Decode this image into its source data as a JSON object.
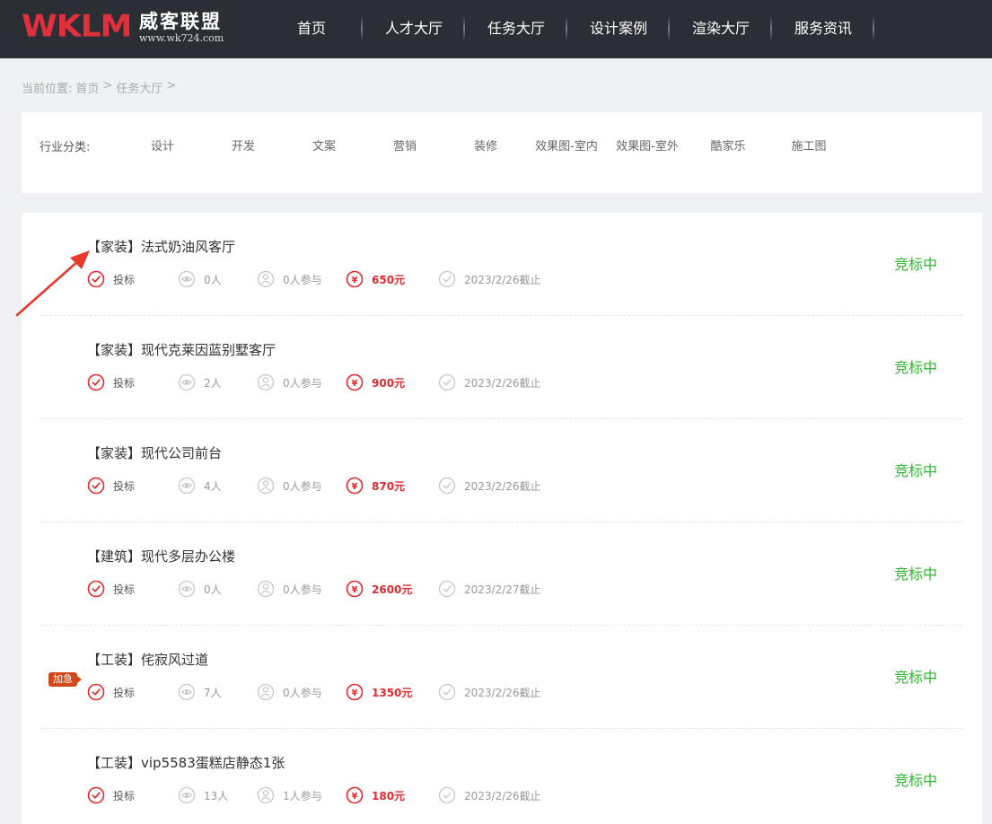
{
  "header": {
    "logo_mark": "WKLM",
    "logo_cn": "威客联盟",
    "logo_url": "www.wk724.com",
    "nav": [
      "首页",
      "人才大厅",
      "任务大厅",
      "设计案例",
      "渲染大厅",
      "服务资讯"
    ]
  },
  "breadcrumb": {
    "prefix": "当前位置:",
    "items": [
      "首页",
      ">",
      "任务大厅",
      ">"
    ]
  },
  "filter": {
    "label": "行业分类:",
    "options": [
      "设计",
      "开发",
      "文案",
      "营销",
      "装修",
      "效果图-室内",
      "效果图-室外",
      "酷家乐",
      "施工图"
    ]
  },
  "tasks": [
    {
      "title": "【家装】法式奶油风客厅",
      "bid": "投标",
      "views": "0人",
      "participants": "0人参与",
      "price": "650元",
      "deadline": "2023/2/26截止",
      "status": "竞标中"
    },
    {
      "title": "【家装】现代克莱因蓝别墅客厅",
      "bid": "投标",
      "views": "2人",
      "participants": "0人参与",
      "price": "900元",
      "deadline": "2023/2/26截止",
      "status": "竞标中"
    },
    {
      "title": "【家装】现代公司前台",
      "bid": "投标",
      "views": "4人",
      "participants": "0人参与",
      "price": "870元",
      "deadline": "2023/2/26截止",
      "status": "竞标中"
    },
    {
      "title": "【建筑】现代多层办公楼",
      "bid": "投标",
      "views": "0人",
      "participants": "0人参与",
      "price": "2600元",
      "deadline": "2023/2/27截止",
      "status": "竞标中"
    },
    {
      "title": "【工装】侘寂风过道",
      "badge": "加急",
      "bid": "投标",
      "views": "7人",
      "participants": "0人参与",
      "price": "1350元",
      "deadline": "2023/2/26截止",
      "status": "竞标中"
    },
    {
      "title": "【工装】vip5583蛋糕店静态1张",
      "bid": "投标",
      "views": "13人",
      "participants": "1人参与",
      "price": "180元",
      "deadline": "2023/2/26截止",
      "status": "竞标中"
    }
  ],
  "colors": {
    "header_bg": "#2b2e34",
    "brand_red": "#e0303c",
    "price_red": "#e3292f",
    "status_green": "#2eb82e",
    "urgent_badge": "#d0491a",
    "annotation_arrow": "#e8392c"
  },
  "icons": {
    "bid": "check-circle-icon",
    "views": "eye-icon",
    "participants": "person-icon",
    "price": "yuan-icon",
    "deadline": "clock-check-icon"
  }
}
